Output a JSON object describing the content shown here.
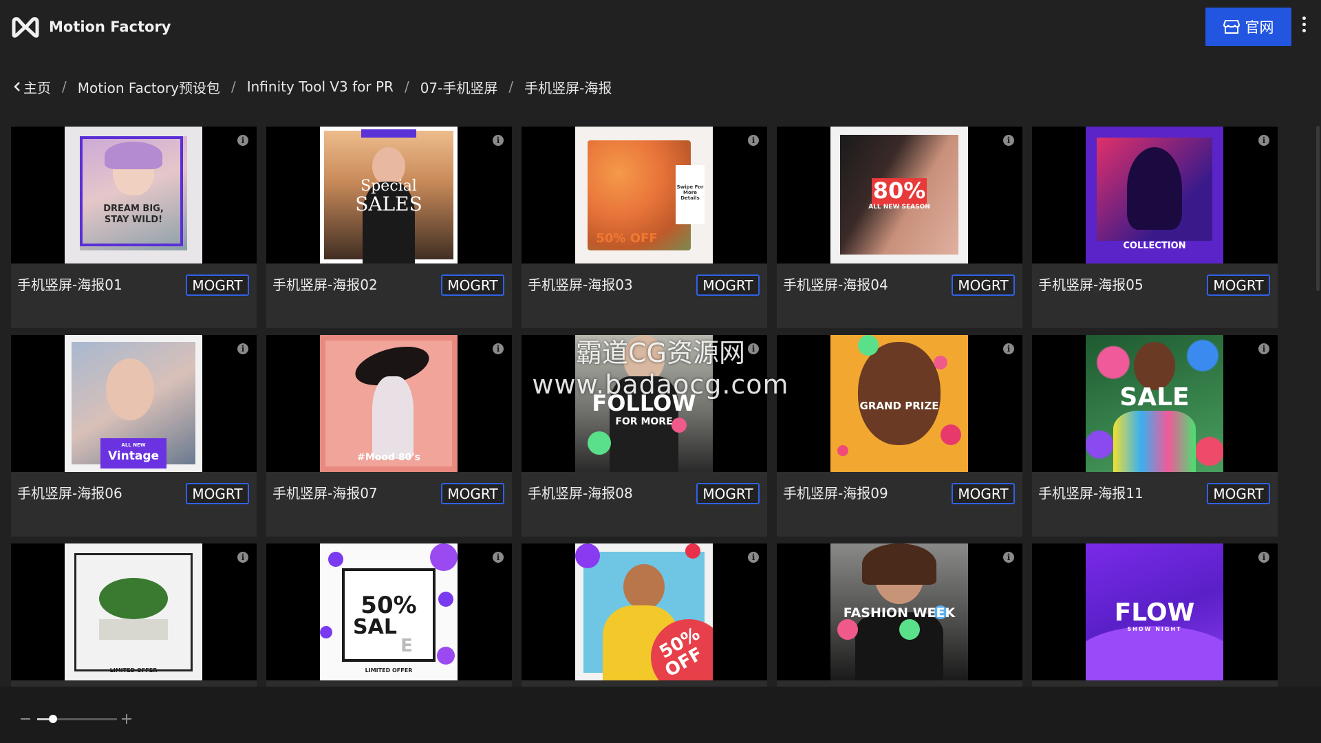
{
  "app": {
    "title": "Motion Factory",
    "site_button": "官网"
  },
  "breadcrumb": [
    "主页",
    "Motion Factory预设包",
    "Infinity Tool V3 for PR",
    "07-手机竖屏",
    "手机竖屏-海报"
  ],
  "breadcrumb_separator": "/",
  "badge_label": "MOGRT",
  "items": [
    {
      "title": "手机竖屏-海报01",
      "overlay": [
        "DREAM BIG,",
        "STAY WILD!"
      ]
    },
    {
      "title": "手机竖屏-海报02",
      "overlay": [
        "Special",
        "SALES"
      ]
    },
    {
      "title": "手机竖屏-海报03",
      "overlay": [
        "50% OFF",
        "Swipe For More Details"
      ]
    },
    {
      "title": "手机竖屏-海报04",
      "overlay": [
        "80%",
        "ALL NEW SEASON"
      ]
    },
    {
      "title": "手机竖屏-海报05",
      "overlay": [
        "COLLECTION"
      ]
    },
    {
      "title": "手机竖屏-海报06",
      "overlay": [
        "ALL NEW",
        "Vintage"
      ]
    },
    {
      "title": "手机竖屏-海报07",
      "overlay": [
        "#Mood 80's"
      ]
    },
    {
      "title": "手机竖屏-海报08",
      "overlay": [
        "FOLLOW",
        "FOR MORE"
      ]
    },
    {
      "title": "手机竖屏-海报09",
      "overlay": [
        "GRAND PRIZE"
      ]
    },
    {
      "title": "手机竖屏-海报11",
      "overlay": [
        "SALE"
      ]
    },
    {
      "title": "",
      "overlay": [
        "LIMITED OFFER"
      ]
    },
    {
      "title": "",
      "overlay": [
        "50%",
        "SAL",
        "E",
        "LIMITED OFFER"
      ]
    },
    {
      "title": "",
      "overlay": [
        "50%",
        "OFF"
      ]
    },
    {
      "title": "",
      "overlay": [
        "FASHION WEEK"
      ]
    },
    {
      "title": "",
      "overlay": [
        "FLOW",
        "SHOW NIGHT"
      ]
    }
  ],
  "watermark": [
    "霸道CG资源网",
    "www.badaocg.com"
  ],
  "zoom_slider": {
    "value": 0.2
  },
  "colors": {
    "accent": "#2356e0",
    "background": "#212121",
    "card": "#2d2d2d"
  }
}
